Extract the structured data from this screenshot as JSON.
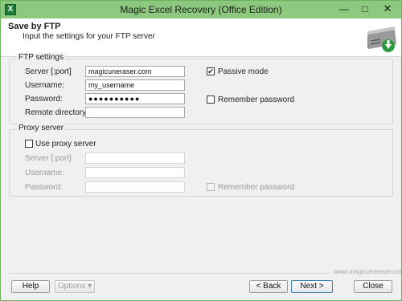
{
  "window": {
    "title": "Magic Excel Recovery (Office Edition)",
    "app_icon_glyph": "X",
    "minimize_glyph": "—",
    "maximize_glyph": "□",
    "close_glyph": "✕"
  },
  "header": {
    "title": "Save by FTP",
    "subtitle": "Input the settings for your FTP server",
    "icon": "ftp-server-icon"
  },
  "ftp": {
    "legend": "FTP settings",
    "server_label": "Server [:port]",
    "server_value": "magicuneraser.com",
    "username_label": "Username:",
    "username_value": "my_username",
    "password_label": "Password:",
    "password_value": "●●●●●●●●●●",
    "remote_dir_label": "Remote directory:",
    "remote_dir_value": "",
    "passive_label": "Passive mode",
    "passive_checked": "✔",
    "remember_label": "Remember password",
    "remember_checked": ""
  },
  "proxy": {
    "legend": "Proxy server",
    "use_label": "Use proxy server",
    "use_checked": "",
    "server_label": "Server [:port]",
    "username_label": "Username:",
    "password_label": "Password:",
    "remember_label": "Remember password"
  },
  "footer": {
    "watermark": "www.magicuneraser.com",
    "help_label": "Help",
    "options_label": "Options ▾",
    "back_label": "< Back",
    "next_label": "Next >",
    "close_label": "Close"
  },
  "colors": {
    "titlebar": "#8cc97f",
    "border": "#6bb35f",
    "default_button": "#3c7fb1"
  }
}
